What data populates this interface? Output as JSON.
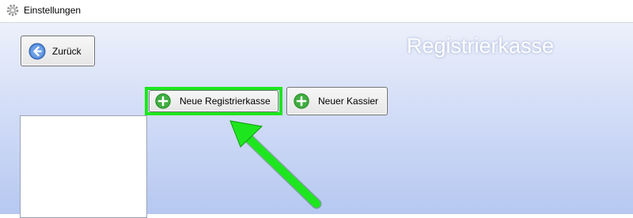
{
  "window": {
    "title": "Einstellungen",
    "icon": "gear-icon"
  },
  "toolbar": {
    "back_label": "Zurück",
    "back_icon": "arrow-left-circle-icon"
  },
  "page": {
    "title": "Registrierkasse"
  },
  "actions": {
    "new_register_label": "Neue Registrierkasse",
    "new_cashier_label": "Neuer Kassier",
    "add_icon": "plus-circle-icon"
  },
  "register_list": {
    "items": []
  },
  "annotation": {
    "highlight_color": "#1ee61e",
    "arrow_color": "#1ee61e"
  }
}
